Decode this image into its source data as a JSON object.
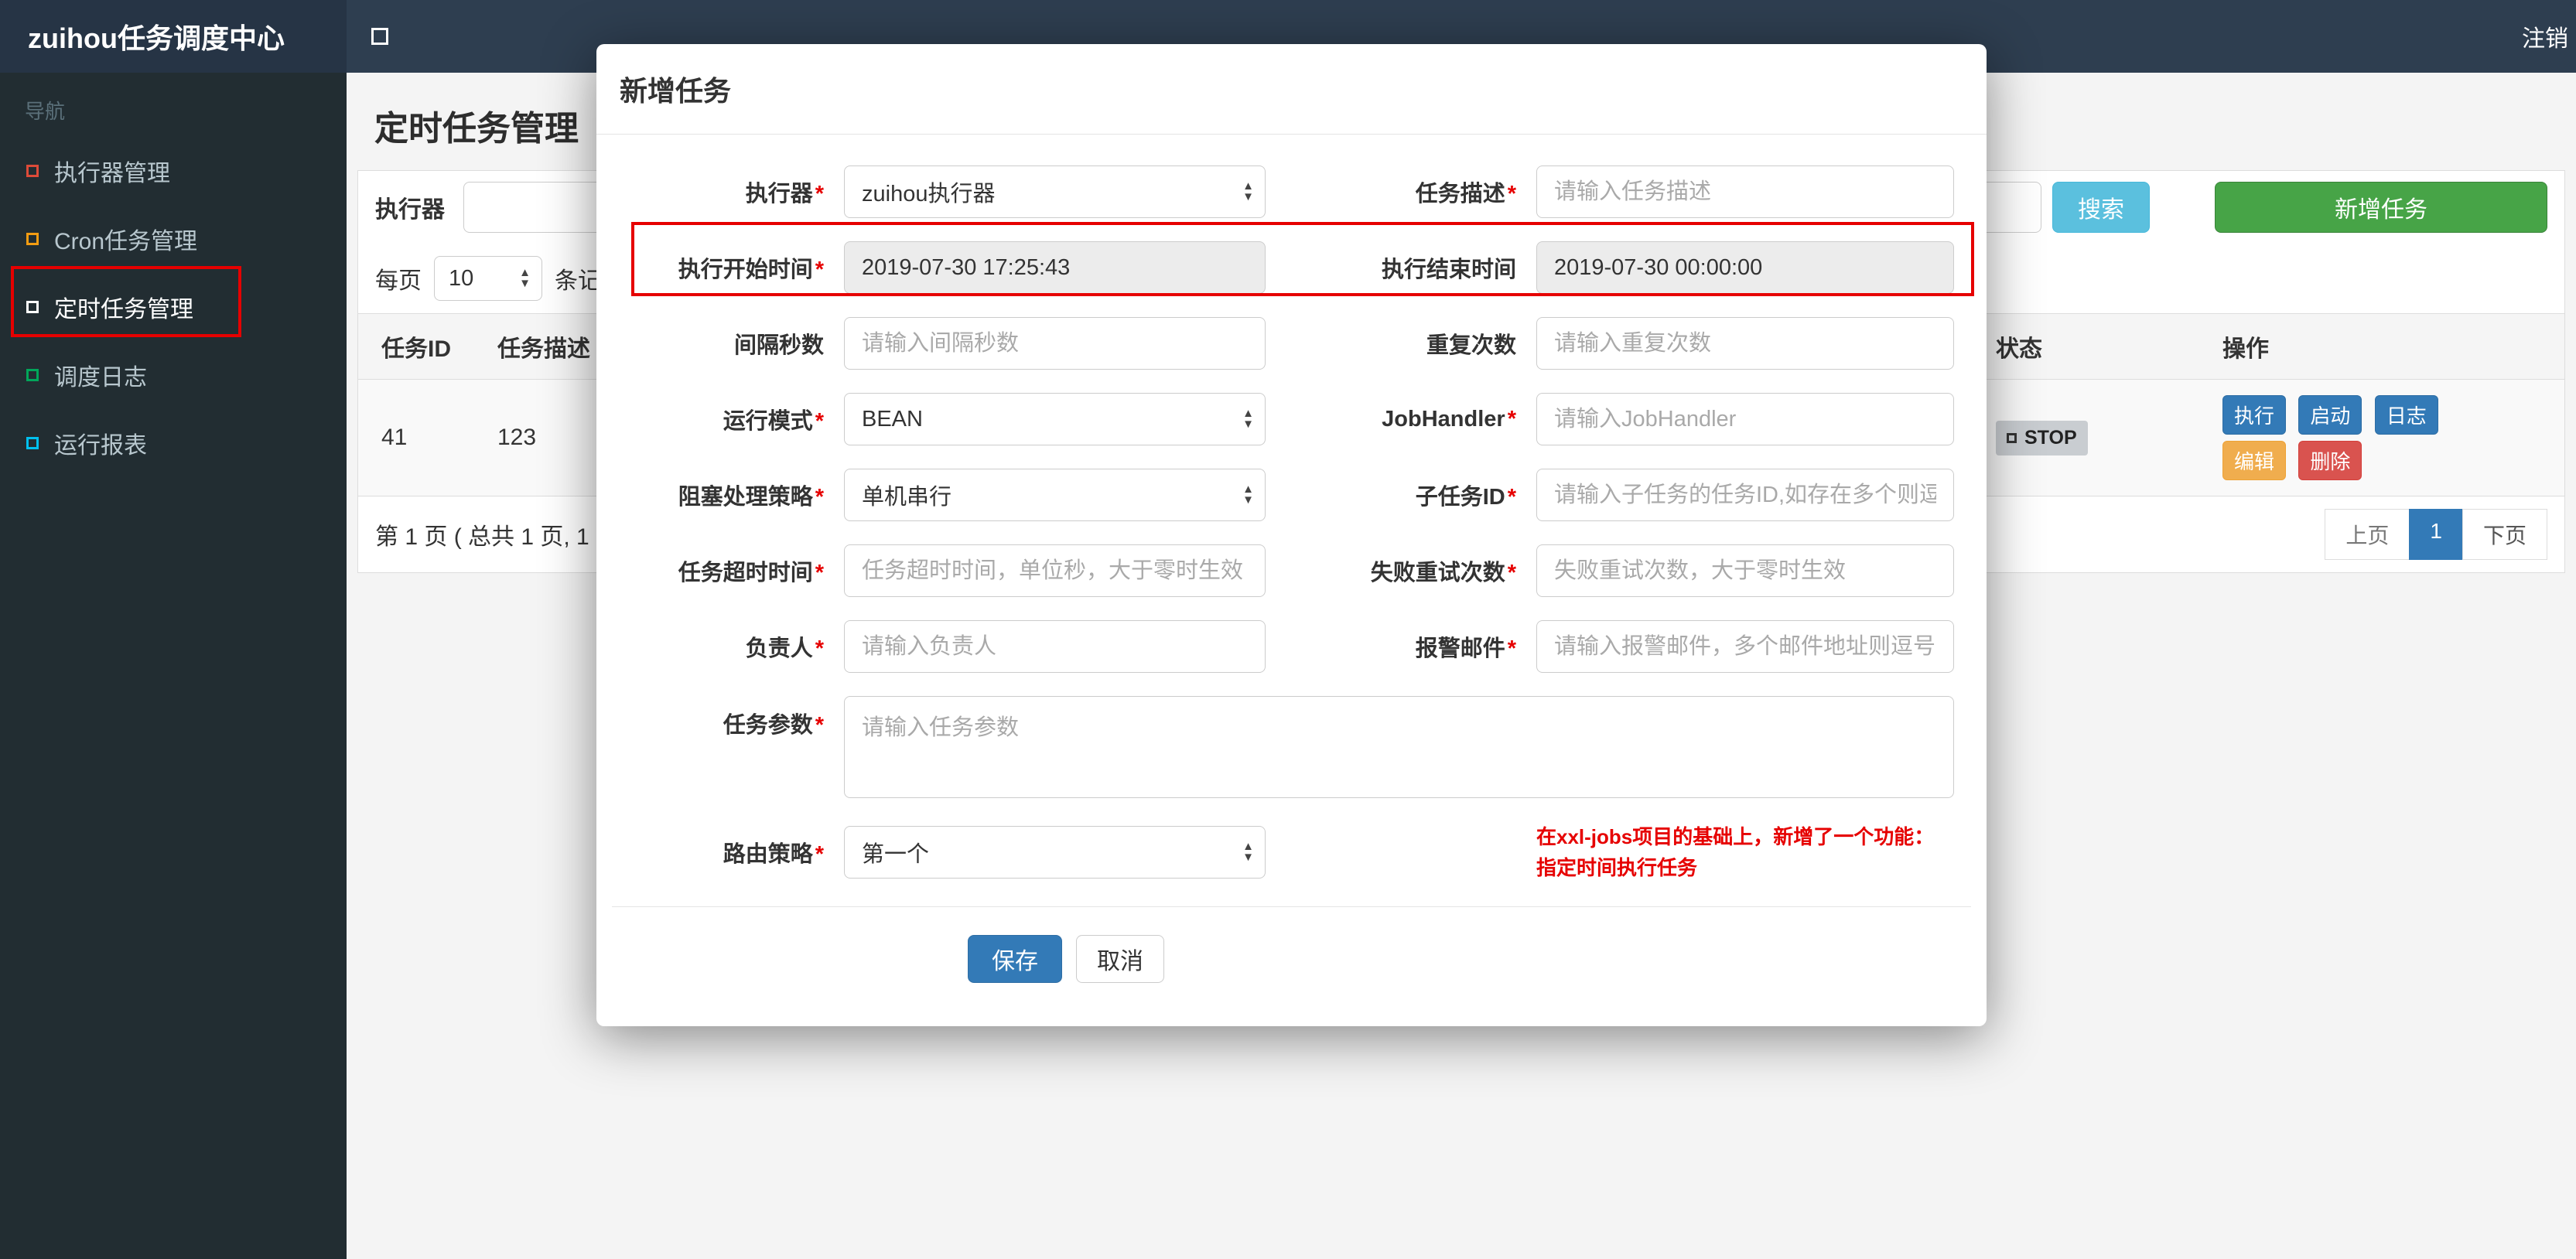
{
  "navbar": {
    "brand": "zuihou任务调度中心",
    "logout": "注销"
  },
  "sidebar": {
    "nav_label": "导航",
    "items": [
      {
        "label": "执行器管理",
        "icon": "square-icon",
        "color": "#dd4b39"
      },
      {
        "label": "Cron任务管理",
        "icon": "square-icon",
        "color": "#f39c12"
      },
      {
        "label": "定时任务管理",
        "icon": "square-icon",
        "color": "#ffffff",
        "active": true,
        "highlighted": true
      },
      {
        "label": "调度日志",
        "icon": "square-icon",
        "color": "#00a65a"
      },
      {
        "label": "运行报表",
        "icon": "square-icon",
        "color": "#00c0ef"
      }
    ]
  },
  "page": {
    "title": "定时任务管理",
    "toolbar": {
      "executor_label": "执行器",
      "search": "搜索",
      "add": "新增任务",
      "search_color": "#5bc0de",
      "add_color": "#47a447"
    },
    "pagesize": {
      "prefix": "每页",
      "value": "10",
      "suffix": "条记录"
    },
    "table": {
      "headers": [
        "任务ID",
        "任务描述",
        "状态",
        "操作"
      ],
      "row": {
        "id": "41",
        "desc": "123",
        "status": "STOP",
        "actions": {
          "run": "执行",
          "start": "启动",
          "log": "日志",
          "edit": "编辑",
          "del": "删除"
        }
      }
    },
    "pagination": {
      "info": "第 1 页 ( 总共 1 页, 1",
      "prev": "上页",
      "current": "1",
      "next": "下页",
      "active_color": "#337ab7"
    }
  },
  "modal": {
    "title": "新增任务",
    "rows": {
      "executor": {
        "label": "执行器",
        "value": "zuihou执行器"
      },
      "job_desc": {
        "label": "任务描述",
        "placeholder": "请输入任务描述"
      },
      "start_time": {
        "label": "执行开始时间",
        "value": "2019-07-30 17:25:43"
      },
      "end_time": {
        "label": "执行结束时间",
        "value": "2019-07-30 00:00:00"
      },
      "interval": {
        "label": "间隔秒数",
        "placeholder": "请输入间隔秒数"
      },
      "repeat": {
        "label": "重复次数",
        "placeholder": "请输入重复次数"
      },
      "run_mode": {
        "label": "运行模式",
        "value": "BEAN"
      },
      "job_handler": {
        "label": "JobHandler",
        "placeholder": "请输入JobHandler"
      },
      "block_strategy": {
        "label": "阻塞处理策略",
        "value": "单机串行"
      },
      "child_job": {
        "label": "子任务ID",
        "placeholder": "请输入子任务的任务ID,如存在多个则逗"
      },
      "timeout": {
        "label": "任务超时时间",
        "placeholder": "任务超时时间，单位秒，大于零时生效"
      },
      "fail_retry": {
        "label": "失败重试次数",
        "placeholder": "失败重试次数，大于零时生效"
      },
      "owner": {
        "label": "负责人",
        "placeholder": "请输入负责人"
      },
      "alarm_email": {
        "label": "报警邮件",
        "placeholder": "请输入报警邮件，多个邮件地址则逗号分"
      },
      "job_param": {
        "label": "任务参数",
        "placeholder": "请输入任务参数"
      },
      "route_strategy": {
        "label": "路由策略",
        "value": "第一个"
      }
    },
    "note": {
      "line1": "在xxl-jobs项目的基础上，新增了一个功能：",
      "line2": "指定时间执行任务",
      "color": "#e60000"
    },
    "save": "保存",
    "cancel": "取消"
  },
  "annotations": {
    "highlight_color": "#e60000"
  }
}
